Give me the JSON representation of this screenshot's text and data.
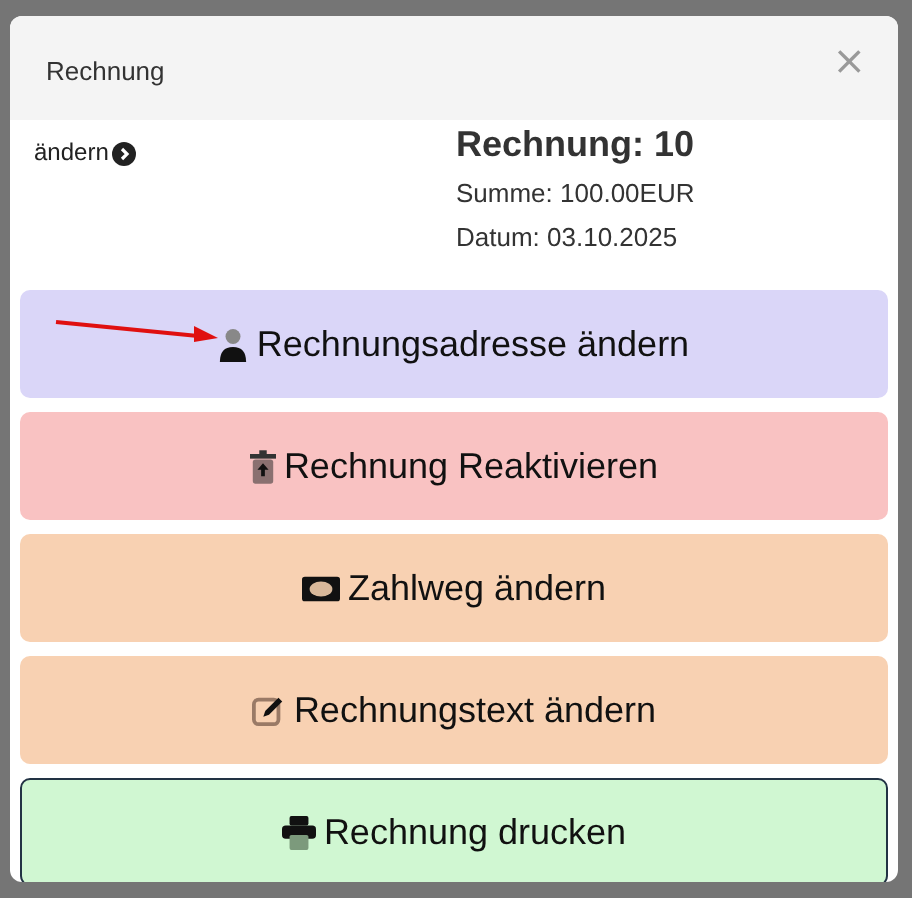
{
  "dialog": {
    "title": "Rechnung",
    "close": "×"
  },
  "left_link": {
    "label": "ändern"
  },
  "invoice": {
    "heading": "Rechnung: 10",
    "sum": "Summe: 100.00EUR",
    "date": "Datum: 03.10.2025"
  },
  "actions": [
    {
      "label": "Rechnungsadresse ändern",
      "kind": "primary",
      "annotated": true
    },
    {
      "label": "Rechnung Reaktivieren",
      "kind": "danger",
      "annotated": false
    },
    {
      "label": "Zahlweg ändern",
      "kind": "warning",
      "annotated": false
    },
    {
      "label": "Rechnungstext ändern",
      "kind": "warning",
      "annotated": false
    },
    {
      "label": "Rechnung drucken",
      "kind": "success",
      "annotated": false
    }
  ]
}
